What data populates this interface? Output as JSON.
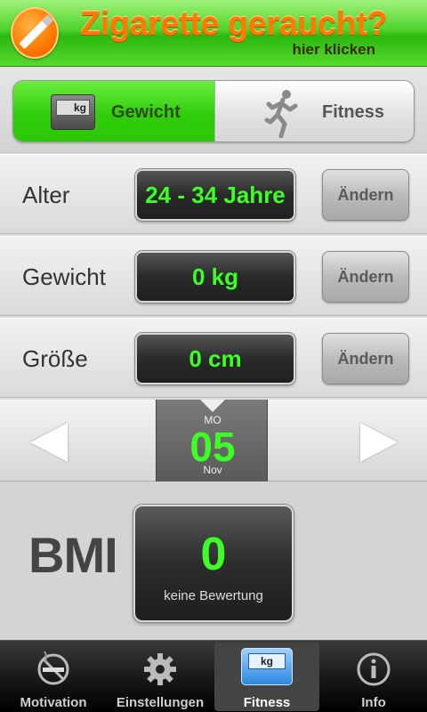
{
  "banner": {
    "title": "Zigarette geraucht?",
    "subtitle": "hier klicken"
  },
  "segment": {
    "left_label": "Gewicht",
    "left_icon_text": "kg",
    "right_label": "Fitness"
  },
  "rows": [
    {
      "label": "Alter",
      "value": "24 - 34 Jahre",
      "button": "Ändern"
    },
    {
      "label": "Gewicht",
      "value": "0 kg",
      "button": "Ändern"
    },
    {
      "label": "Größe",
      "value": "0 cm",
      "button": "Ändern"
    }
  ],
  "date_picker": {
    "weekday": "MO",
    "day": "05",
    "month": "Nov"
  },
  "bmi": {
    "label": "BMI",
    "value": "0",
    "rating": "keine Bewertung"
  },
  "tabs": [
    {
      "label": "Motivation",
      "icon": "no-smoking-icon",
      "active": false
    },
    {
      "label": "Einstellungen",
      "icon": "gear-icon",
      "active": false
    },
    {
      "label": "Fitness",
      "icon": "scale-icon",
      "icon_text": "kg",
      "active": true
    },
    {
      "label": "Info",
      "icon": "info-icon",
      "active": false
    }
  ],
  "colors": {
    "accent_green": "#3dff27",
    "banner_orange": "#ff7a00",
    "segment_active": "#30cd0b"
  }
}
